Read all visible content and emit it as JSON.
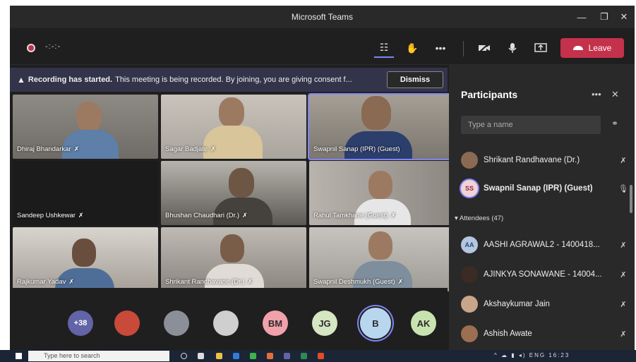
{
  "window": {
    "title": "Microsoft Teams",
    "controls": [
      "minimize-icon",
      "restore-icon",
      "close-icon"
    ]
  },
  "toolbar": {
    "timer": "-:-:-",
    "buttons": [
      "people-icon",
      "raise-hand-icon",
      "more-icon",
      "camera-off-icon",
      "mic-icon",
      "share-screen-icon"
    ],
    "leave_label": "Leave",
    "leave_color": "#c4314b"
  },
  "banner": {
    "bold": "Recording has started.",
    "text": "This meeting is being recorded. By joining, you are giving consent f...",
    "dismiss_label": "Dismiss"
  },
  "video_tiles": [
    {
      "name": "Dhiraj Bhandarkar",
      "muted": true
    },
    {
      "name": "Sagar Badjate",
      "muted": true
    },
    {
      "name": "Swapnil Sanap (IPR) (Guest)",
      "muted": false
    },
    {
      "name": "Sandeep Ushkewar",
      "muted": true
    },
    {
      "name": "Bhushan Chaudhari (Dr.)",
      "muted": true
    },
    {
      "name": "Rahul Tamkhane (Guest)",
      "muted": true
    },
    {
      "name": "Rajkumar Yadav",
      "muted": true
    },
    {
      "name": "Shrikant Randhavane (Dr.)",
      "muted": true
    },
    {
      "name": "Swapnil Deshmukh (Guest)",
      "muted": true
    }
  ],
  "avatar_strip": [
    {
      "label": "+38",
      "color": "#6264a7"
    },
    {
      "label": "",
      "color": "#c94a3a"
    },
    {
      "label": "",
      "color": "#8a8f98"
    },
    {
      "label": "",
      "color": "#cfcfcf"
    },
    {
      "label": "BM",
      "color": "#f1a1aa"
    },
    {
      "label": "JG",
      "color": "#d4e6c2"
    },
    {
      "label": "B",
      "color": "#b8d7ef"
    },
    {
      "label": "AK",
      "color": "#c8e3b0"
    }
  ],
  "participants": {
    "title": "Participants",
    "search_placeholder": "Type a name",
    "presenters": [
      {
        "name": "Shrikant Randhavane (Dr.)",
        "initials": "",
        "mic": "muted"
      },
      {
        "name": "Swapnil Sanap (IPR) (Guest)",
        "initials": "SS",
        "mic": "on"
      }
    ],
    "attendees_label": "Attendees (47)",
    "attendees": [
      {
        "name": "AASHI AGRAWAL2 - 1400418...",
        "initials": "AA",
        "mic": "muted"
      },
      {
        "name": "AJINKYA SONAWANE - 14004...",
        "initials": "",
        "mic": "muted"
      },
      {
        "name": "Akshaykumar Jain",
        "initials": "",
        "mic": "muted"
      },
      {
        "name": "Ashish Awate",
        "initials": "",
        "mic": "muted"
      }
    ]
  },
  "taskbar": {
    "search_placeholder": "Type here to search",
    "tray_lang": "ENG",
    "clock": "16:23"
  }
}
